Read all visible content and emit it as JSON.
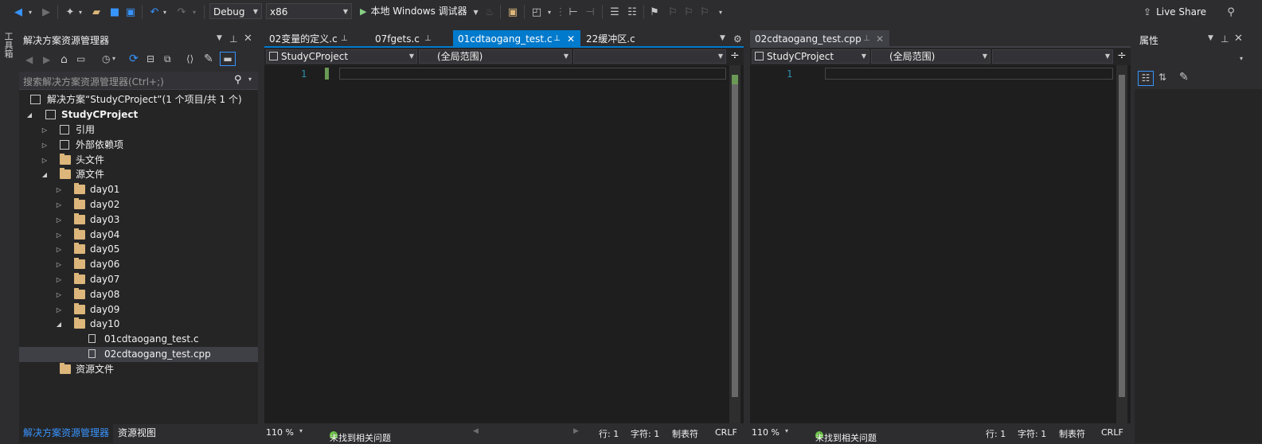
{
  "toolbar": {
    "config": "Debug",
    "platform": "x86",
    "run_label": "本地 Windows 调试器",
    "live_share": "Live Share"
  },
  "toolstrip": {
    "label": "工具箱"
  },
  "solution_explorer": {
    "title": "解决方案资源管理器",
    "search_placeholder": "搜索解决方案资源管理器(Ctrl+;)",
    "solution": "解决方案“StudyCProject”(1 个项目/共 1 个)",
    "project": "StudyCProject",
    "items": [
      {
        "label": "引用",
        "expander": "▷",
        "depth": 2,
        "icon": "references-icon"
      },
      {
        "label": "外部依赖项",
        "expander": "▷",
        "depth": 2,
        "icon": "external-deps-icon"
      },
      {
        "label": "头文件",
        "expander": "▷",
        "depth": 2,
        "icon": "folder-icon"
      },
      {
        "label": "源文件",
        "expander": "◢",
        "depth": 2,
        "icon": "folder-icon"
      },
      {
        "label": "day01",
        "expander": "▷",
        "depth": 3,
        "icon": "folder-icon"
      },
      {
        "label": "day02",
        "expander": "▷",
        "depth": 3,
        "icon": "folder-icon"
      },
      {
        "label": "day03",
        "expander": "▷",
        "depth": 3,
        "icon": "folder-icon"
      },
      {
        "label": "day04",
        "expander": "▷",
        "depth": 3,
        "icon": "folder-icon"
      },
      {
        "label": "day05",
        "expander": "▷",
        "depth": 3,
        "icon": "folder-icon"
      },
      {
        "label": "day06",
        "expander": "▷",
        "depth": 3,
        "icon": "folder-icon"
      },
      {
        "label": "day07",
        "expander": "▷",
        "depth": 3,
        "icon": "folder-icon"
      },
      {
        "label": "day08",
        "expander": "▷",
        "depth": 3,
        "icon": "folder-icon"
      },
      {
        "label": "day09",
        "expander": "▷",
        "depth": 3,
        "icon": "folder-icon"
      },
      {
        "label": "day10",
        "expander": "◢",
        "depth": 3,
        "icon": "folder-icon"
      },
      {
        "label": "01cdtaogang_test.c",
        "expander": "",
        "depth": 4,
        "icon": "c-file-icon"
      },
      {
        "label": "02cdtaogang_test.cpp",
        "expander": "",
        "depth": 4,
        "icon": "cpp-file-icon",
        "selected": true
      },
      {
        "label": "资源文件",
        "expander": "",
        "depth": 2,
        "icon": "folder-icon"
      }
    ],
    "bottom_tabs": [
      "解决方案资源管理器",
      "资源视图"
    ]
  },
  "editor_left": {
    "tabs": [
      {
        "label": "02变量的定义.c",
        "active": false
      },
      {
        "label": "07fgets.c",
        "active": false
      },
      {
        "label": "01cdtaogang_test.c",
        "active": true
      },
      {
        "label": "22缓冲区.c",
        "active": false
      }
    ],
    "nav_project": "StudyCProject",
    "nav_scope": "(全局范围)",
    "line_number": "1",
    "status": {
      "zoom": "110 %",
      "issues": "未找到相关问题",
      "line": "行: 1",
      "col": "字符: 1",
      "tabs": "制表符",
      "eol": "CRLF"
    }
  },
  "editor_right": {
    "tabs": [
      {
        "label": "02cdtaogang_test.cpp",
        "active": false
      }
    ],
    "nav_project": "StudyCProject",
    "nav_scope": "(全局范围)",
    "line_number": "1",
    "status": {
      "zoom": "110 %",
      "issues": "未找到相关问题",
      "line": "行: 1",
      "col": "字符: 1",
      "tabs": "制表符",
      "eol": "CRLF"
    }
  },
  "properties": {
    "title": "属性"
  },
  "colors": {
    "accent": "#007acc",
    "line_number": "#2b91af",
    "folder": "#dcb67a",
    "ok": "#6cc644"
  }
}
